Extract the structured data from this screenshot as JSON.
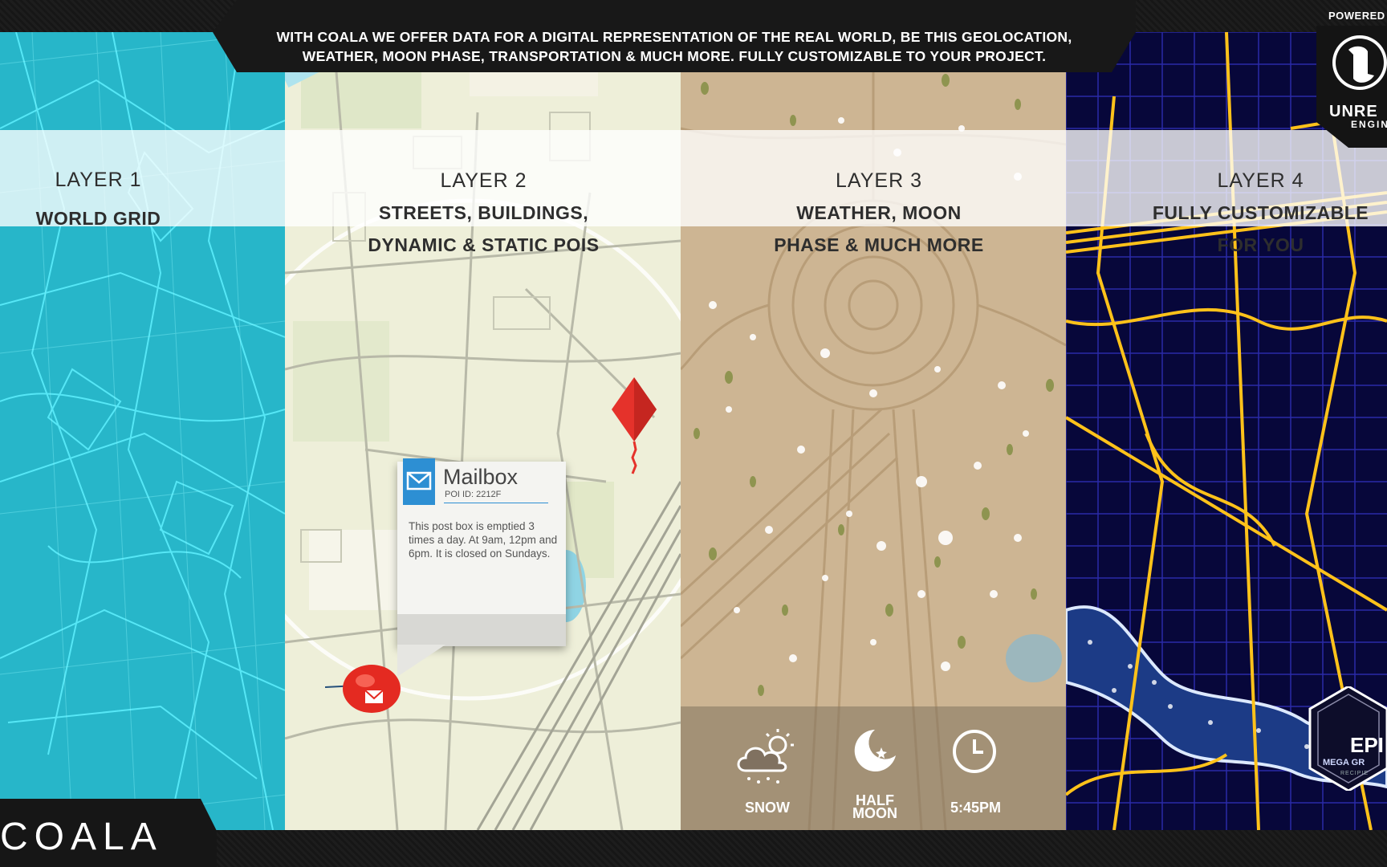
{
  "banner": {
    "line1": "WITH COALA WE OFFER DATA FOR A DIGITAL REPRESENTATION OF THE REAL WORLD, BE THIS GEOLOCATION,",
    "line2": "WEATHER, MOON PHASE, TRANSPORTATION & MUCH MORE. FULLY CUSTOMIZABLE TO YOUR PROJECT."
  },
  "powered": {
    "label": "POWERED",
    "engine_name": "UNRE",
    "engine_sub": "ENGIN"
  },
  "layers": [
    {
      "num": "LAYER 1",
      "title_line1": "WORLD GRID",
      "title_line2": ""
    },
    {
      "num": "LAYER 2",
      "title_line1": "STREETS, BUILDINGS,",
      "title_line2": "DYNAMIC & STATIC POIS"
    },
    {
      "num": "LAYER 3",
      "title_line1": "WEATHER, MOON",
      "title_line2": "PHASE & MUCH MORE"
    },
    {
      "num": "LAYER 4",
      "title_line1": "FULLY CUSTOMIZABLE",
      "title_line2": "FOR YOU"
    }
  ],
  "poi_card": {
    "title": "Mailbox",
    "poi_id": "POI ID: 2212F",
    "description": "This post box is emptied 3 times a day. At 9am, 12pm and 6pm. It is closed on Sundays."
  },
  "weather": {
    "condition": "SNOW",
    "moon_line1": "HALF",
    "moon_line2": "MOON",
    "time": "5:45PM"
  },
  "brand": {
    "logo": "COALA"
  },
  "epic_badge": {
    "line1": "EPI",
    "line2": "MEGA GR",
    "line3": "RECIPIE"
  },
  "icons": [
    "mail-icon",
    "kite-marker-icon",
    "pin-icon",
    "cloud-sun-snow-icon",
    "moon-star-icon",
    "clock-icon",
    "unreal-logo-icon",
    "epic-megagrant-badge-icon"
  ],
  "colors": {
    "grid_layer": "#27b6c9",
    "street_layer": "#eeefd9",
    "weather_layer": "#cdb593",
    "custom_layer": "#07073a",
    "accent_blue": "#2d8fd3",
    "neon_yellow": "#ffc21a"
  }
}
